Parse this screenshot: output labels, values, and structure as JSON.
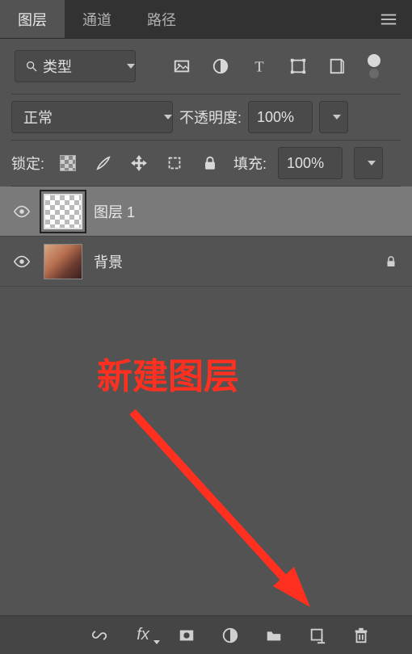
{
  "tabs": {
    "layers": "图层",
    "channels": "通道",
    "paths": "路径"
  },
  "filter": {
    "kind_label": "类型"
  },
  "blend": {
    "mode": "正常",
    "opacity_label": "不透明度:",
    "opacity_value": "100%"
  },
  "lock": {
    "label": "锁定:",
    "fill_label": "填充:",
    "fill_value": "100%"
  },
  "layers": [
    {
      "name": "图层 1",
      "visible": true,
      "locked": false,
      "selected": true,
      "thumb": "transparent"
    },
    {
      "name": "背景",
      "visible": true,
      "locked": true,
      "selected": false,
      "thumb": "photo"
    }
  ],
  "annotation": {
    "text": "新建图层"
  },
  "icons": {
    "search": "search-icon",
    "image": "image-icon",
    "contrast": "contrast-icon",
    "type": "type-icon",
    "shape": "shape-icon",
    "artboard": "artboard-icon",
    "link": "link-icon",
    "fx": "fx-icon",
    "mask": "mask-icon",
    "adjust": "adjustment-icon",
    "group": "group-icon",
    "new": "new-layer-icon",
    "trash": "trash-icon"
  }
}
